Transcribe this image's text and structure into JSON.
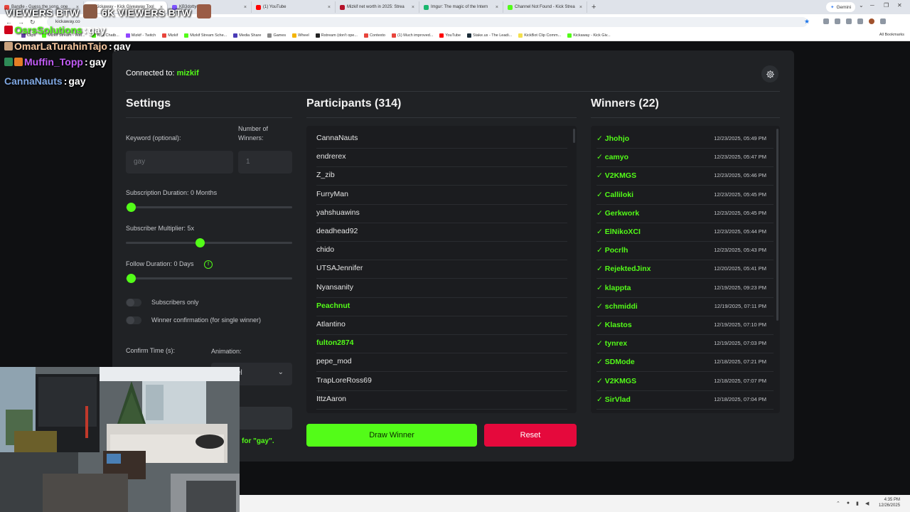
{
  "browser": {
    "tabs": [
      {
        "label": "Bandle - Guess the song, one",
        "color": "#e8453c"
      },
      {
        "label": "Kickaway - Kick Giveaway Tool",
        "color": "#53fc18",
        "active": true
      },
      {
        "label": "KB3dotty(312)",
        "color": "#7f55ff"
      },
      {
        "label": "(1) YouTube",
        "color": "#ff0000"
      },
      {
        "label": "Mizkif net worth in 2025: Strea",
        "color": "#b5122a"
      },
      {
        "label": "Imgur: The magic of the Intern",
        "color": "#1bb76e"
      },
      {
        "label": "Channel Not Found - Kick Strea",
        "color": "#53fc18"
      }
    ],
    "new_tab": "+",
    "gemini_label": "Gemini",
    "url": "kickaway.co",
    "bookmarks": [
      {
        "label": "Clips",
        "color": "#6441a5"
      },
      {
        "label": "Mizkif Stream - Wat...",
        "color": "#53fc18"
      },
      {
        "label": "Kick Chatb...",
        "color": "#53fc18"
      },
      {
        "label": "Mizkif - Twitch",
        "color": "#9146ff"
      },
      {
        "label": "Mizkif",
        "color": "#e8453c"
      },
      {
        "label": "Mizkif Stream Sche...",
        "color": "#53fc18"
      },
      {
        "label": "Media Share",
        "color": "#4a3bb7"
      },
      {
        "label": "Games",
        "color": "#888888"
      },
      {
        "label": "Wheel",
        "color": "#f4b400"
      },
      {
        "label": "Rstream (don't ope...",
        "color": "#222222"
      },
      {
        "label": "Contexto",
        "color": "#e8453c"
      },
      {
        "label": "(1) Much improved...",
        "color": "#e8453c"
      },
      {
        "label": "YouTube",
        "color": "#ff0000"
      },
      {
        "label": "Stake.us - The Leadi...",
        "color": "#1a2c38"
      },
      {
        "label": "KickBot Clip Comm...",
        "color": "#f4e04d"
      },
      {
        "label": "Kickaway - Kick Giv...",
        "color": "#53fc18"
      }
    ],
    "all_bookmarks": "All Bookmarks"
  },
  "overlay": {
    "viewers_left": "VIEWERS BTW",
    "viewers_right": "6K VIEWERS BTW"
  },
  "chat": [
    {
      "user": "OsrsSolutions",
      "msg": "gay",
      "color": "#53fc18"
    },
    {
      "user": "OmarLaTurahinTajo",
      "msg": "gay",
      "color": "#f7c8a0"
    },
    {
      "user": "Muffin_Topp",
      "msg": "gay",
      "color": "#c25cf7"
    },
    {
      "user": "CannaNauts",
      "msg": "gay",
      "color": "#7ea6e0"
    }
  ],
  "app": {
    "connected_label": "Connected to:",
    "channel": "mizkif",
    "settings": {
      "title": "Settings",
      "keyword_label": "Keyword (optional):",
      "keyword_value": "gay",
      "winners_label": "Number of Winners:",
      "winners_value": "1",
      "sub_duration_label": "Subscription Duration: 0 Months",
      "sub_duration_value": 0,
      "sub_multiplier_label": "Subscriber Multiplier: 5x",
      "sub_multiplier_value": 5,
      "follow_duration_label": "Follow Duration: 0 Days",
      "follow_duration_value": 0,
      "info_glyph": "!",
      "subs_only_label": "Subscribers only",
      "winner_confirm_label": "Winner confirmation (for single winner)",
      "confirm_time_label": "Confirm Time (s):",
      "animation_label": "Animation:",
      "animation_value": "el",
      "keyword_status": "for \"gay\"."
    },
    "participants": {
      "title": "Participants (314)",
      "names": [
        {
          "name": "CannaNauts",
          "highlight": false
        },
        {
          "name": "endrerex",
          "highlight": false
        },
        {
          "name": "Z_zib",
          "highlight": false
        },
        {
          "name": "FurryMan",
          "highlight": false
        },
        {
          "name": "yahshuawins",
          "highlight": false
        },
        {
          "name": "deadhead92",
          "highlight": false
        },
        {
          "name": "chido",
          "highlight": false
        },
        {
          "name": "UTSAJennifer",
          "highlight": false
        },
        {
          "name": "Nyansanity",
          "highlight": false
        },
        {
          "name": "Peachnut",
          "highlight": true
        },
        {
          "name": "Atlantino",
          "highlight": false
        },
        {
          "name": "fulton2874",
          "highlight": true
        },
        {
          "name": "pepe_mod",
          "highlight": false
        },
        {
          "name": "TrapLoreRoss69",
          "highlight": false
        },
        {
          "name": "IttzAaron",
          "highlight": false
        }
      ]
    },
    "winners": {
      "title": "Winners (22)",
      "check": "✓",
      "list": [
        {
          "name": "Jhohjo",
          "time": "12/23/2025, 05:49 PM"
        },
        {
          "name": "camyo",
          "time": "12/23/2025, 05:47 PM"
        },
        {
          "name": "V2KMGS",
          "time": "12/23/2025, 05:46 PM"
        },
        {
          "name": "Calliloki",
          "time": "12/23/2025, 05:45 PM"
        },
        {
          "name": "Gerkwork",
          "time": "12/23/2025, 05:45 PM"
        },
        {
          "name": "ElNikoXCI",
          "time": "12/23/2025, 05:44 PM"
        },
        {
          "name": "Pocrlh",
          "time": "12/23/2025, 05:43 PM"
        },
        {
          "name": "RejektedJinx",
          "time": "12/20/2025, 05:41 PM"
        },
        {
          "name": "klappta",
          "time": "12/19/2025, 09:23 PM"
        },
        {
          "name": "schmiddi",
          "time": "12/19/2025, 07:11 PM"
        },
        {
          "name": "Klastos",
          "time": "12/19/2025, 07:10 PM"
        },
        {
          "name": "tynrex",
          "time": "12/19/2025, 07:03 PM"
        },
        {
          "name": "SDMode",
          "time": "12/18/2025, 07:21 PM"
        },
        {
          "name": "V2KMGS",
          "time": "12/18/2025, 07:07 PM"
        },
        {
          "name": "SirVlad",
          "time": "12/18/2025, 07:04 PM"
        }
      ]
    },
    "draw_label": "Draw Winner",
    "reset_label": "Reset"
  },
  "taskbar": {
    "time": "4:35 PM",
    "date": "12/26/2025"
  },
  "colors": {
    "accent": "#53fc18",
    "danger": "#e5093c",
    "panel": "#202225"
  }
}
